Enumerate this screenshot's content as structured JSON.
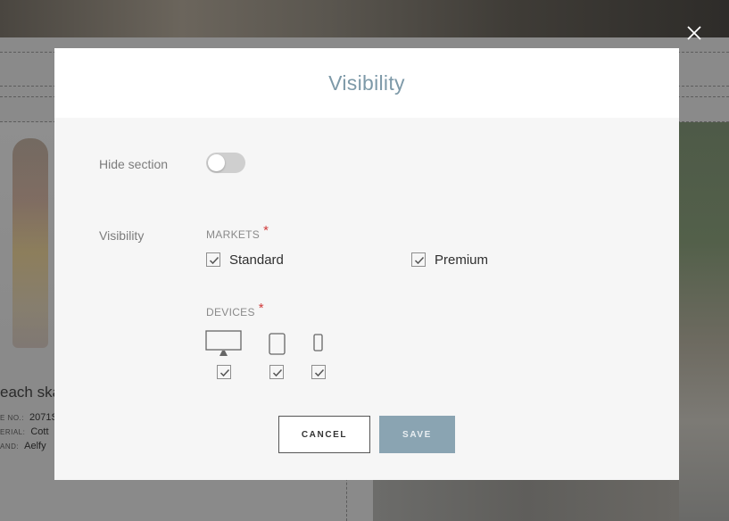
{
  "background": {
    "product_title": "each ska",
    "meta": [
      {
        "key": "E NO.:",
        "value": "2071S"
      },
      {
        "key": "ERIAL:",
        "value": "Cott"
      },
      {
        "key": "AND:",
        "value": "Aelfy"
      }
    ]
  },
  "modal": {
    "title": "Visibility",
    "hide_section_label": "Hide section",
    "hide_section_enabled": false,
    "visibility_label": "Visibility",
    "markets": {
      "label": "MARKETS",
      "required_mark": "*",
      "options": [
        {
          "label": "Standard",
          "checked": true
        },
        {
          "label": "Premium",
          "checked": true
        }
      ]
    },
    "devices": {
      "label": "DEVICES",
      "required_mark": "*",
      "options": [
        {
          "icon": "desktop-icon",
          "checked": true
        },
        {
          "icon": "tablet-icon",
          "checked": true
        },
        {
          "icon": "phone-icon",
          "checked": true
        }
      ]
    },
    "buttons": {
      "cancel": "CANCEL",
      "save": "SAVE"
    }
  },
  "colors": {
    "title": "#7d99a8",
    "save_button": "#8aa4b2",
    "required": "#d03a3a"
  }
}
